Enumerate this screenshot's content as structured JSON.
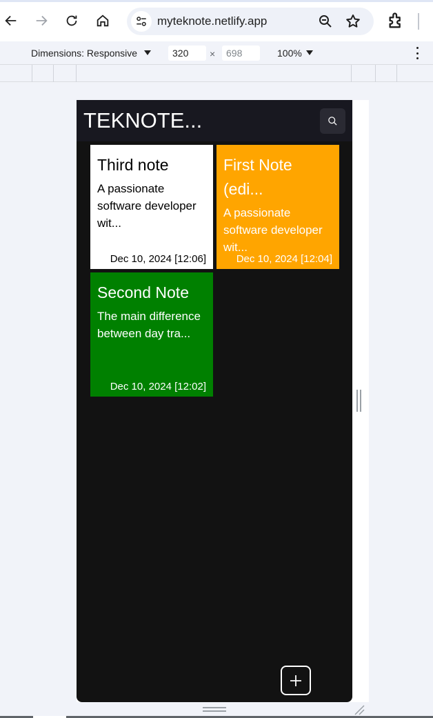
{
  "browser": {
    "url": "myteknote.netlify.app",
    "icons": [
      "back-arrow-icon",
      "forward-arrow-icon",
      "reload-icon",
      "home-icon",
      "site-settings-icon",
      "zoom-magnifier-icon",
      "bookmark-star-icon",
      "extensions-puzzle-icon"
    ]
  },
  "devtools": {
    "dimensions_label": "Dimensions: Responsive",
    "width_value": "320",
    "times_symbol": "×",
    "height_placeholder": "698",
    "zoom_label": "100%"
  },
  "app": {
    "title": "TEKNOTE...",
    "notes": [
      {
        "title": "Third note",
        "body": "A passionate software developer wit...",
        "date": "Dec 10, 2024 [12:06]",
        "color": "#ffffff"
      },
      {
        "title": "First Note (edi...",
        "body": "A passionate software developer wit...",
        "date": "Dec 10, 2024 [12:04]",
        "color": "#ffa500"
      },
      {
        "title": "Second Note",
        "body": "The main difference between day tra...",
        "date": "Dec 10, 2024 [12:02]",
        "color": "#008000"
      }
    ],
    "add_symbol": "+"
  },
  "colors": {
    "app_background": "#121212",
    "header_background": "#181820",
    "browser_chrome": "#f1f3f9"
  }
}
